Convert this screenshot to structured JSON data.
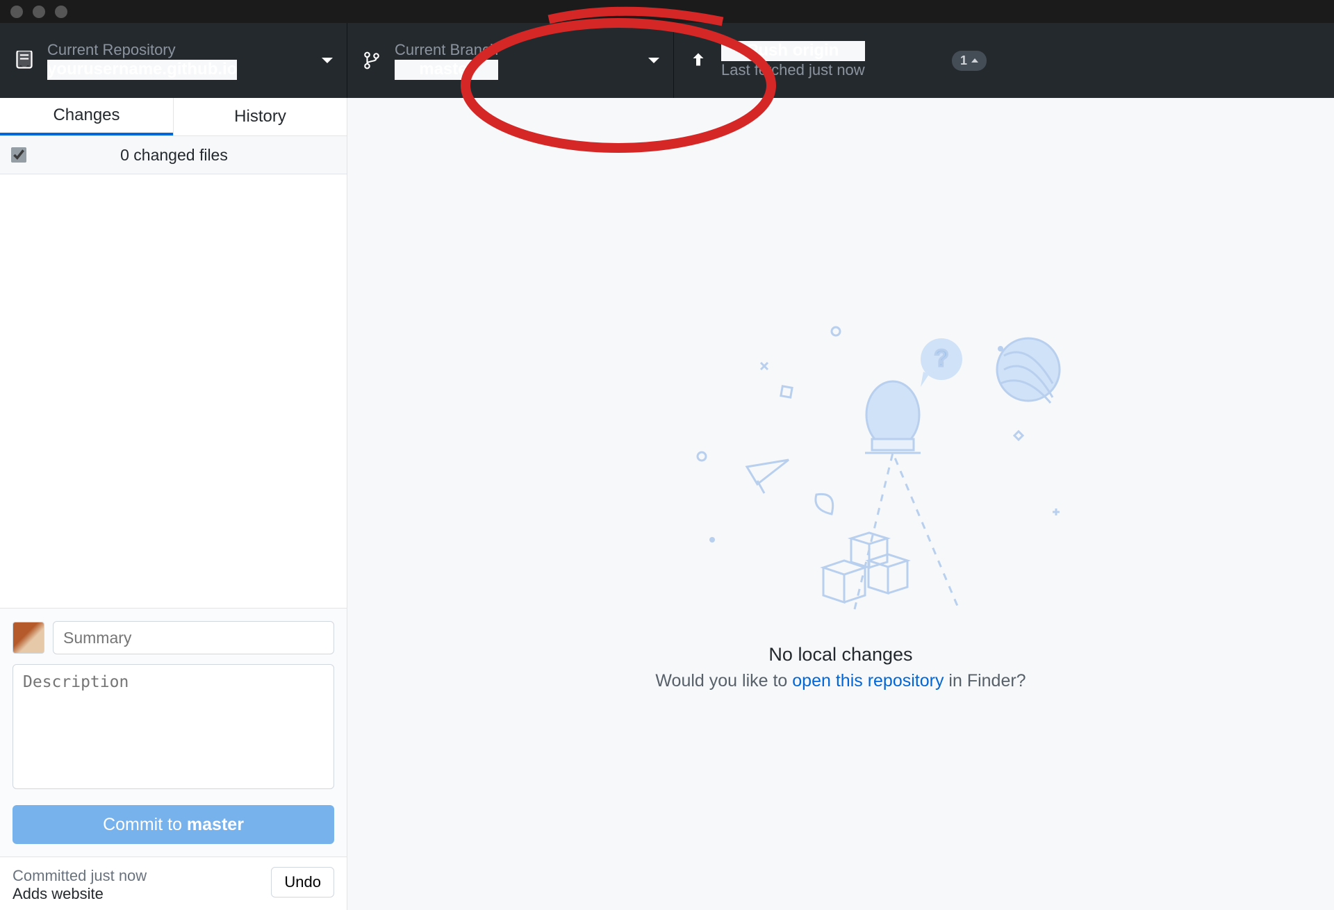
{
  "toolbar": {
    "repo": {
      "label": "Current Repository",
      "value": "yourusername.github.io"
    },
    "branch": {
      "label": "Current Branch",
      "value": "master"
    },
    "push": {
      "label": "Push origin",
      "value": "Last fetched just now",
      "badge": "1"
    }
  },
  "tabs": {
    "changes": "Changes",
    "history": "History"
  },
  "changed_files": "0 changed files",
  "commit": {
    "summary_placeholder": "Summary",
    "description_placeholder": "Description",
    "button_prefix": "Commit to ",
    "button_branch": "master"
  },
  "recent": {
    "line1": "Committed just now",
    "line2": "Adds website",
    "undo": "Undo"
  },
  "empty": {
    "title": "No local changes",
    "prefix": "Would you like to ",
    "link": "open this repository",
    "suffix": " in Finder?"
  }
}
